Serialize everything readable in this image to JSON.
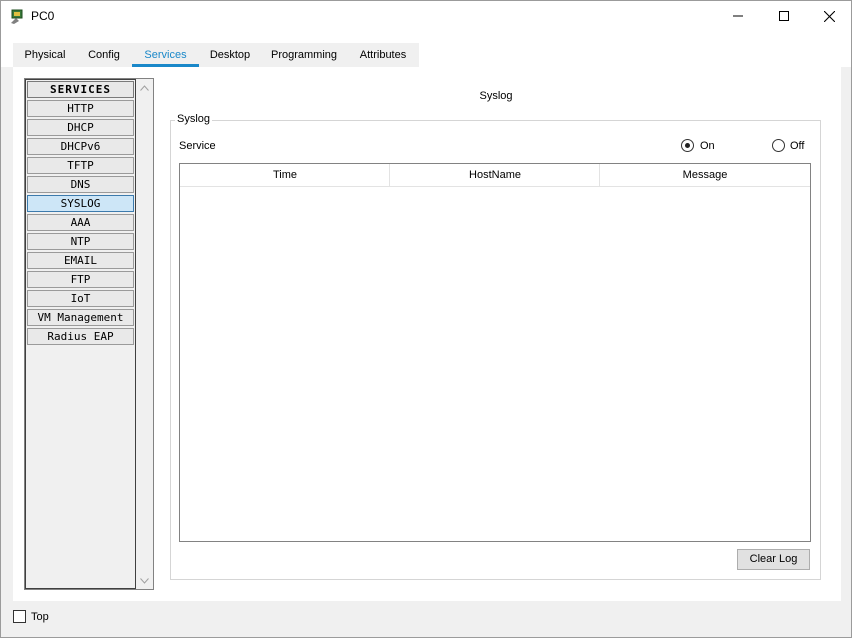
{
  "window": {
    "title": "PC0"
  },
  "tabs": [
    {
      "label": "Physical",
      "active": false
    },
    {
      "label": "Config",
      "active": false
    },
    {
      "label": "Services",
      "active": true
    },
    {
      "label": "Desktop",
      "active": false
    },
    {
      "label": "Programming",
      "active": false
    },
    {
      "label": "Attributes",
      "active": false
    }
  ],
  "sidebar": {
    "header": "SERVICES",
    "items": [
      {
        "label": "HTTP"
      },
      {
        "label": "DHCP"
      },
      {
        "label": "DHCPv6"
      },
      {
        "label": "TFTP"
      },
      {
        "label": "DNS"
      },
      {
        "label": "SYSLOG",
        "selected": true
      },
      {
        "label": "AAA"
      },
      {
        "label": "NTP"
      },
      {
        "label": "EMAIL"
      },
      {
        "label": "FTP"
      },
      {
        "label": "IoT"
      },
      {
        "label": "VM Management"
      },
      {
        "label": "Radius EAP"
      }
    ]
  },
  "main": {
    "title": "Syslog",
    "group_label": "Syslog",
    "service_label": "Service",
    "radio_on": "On",
    "radio_off": "Off",
    "service_state": "On",
    "table": {
      "columns": [
        "Time",
        "HostName",
        "Message"
      ],
      "rows": []
    },
    "clear_button": "Clear Log"
  },
  "footer": {
    "top_label": "Top",
    "top_checked": false
  },
  "colors": {
    "accent": "#1a88c9",
    "selected_item": "#cde6f7"
  }
}
